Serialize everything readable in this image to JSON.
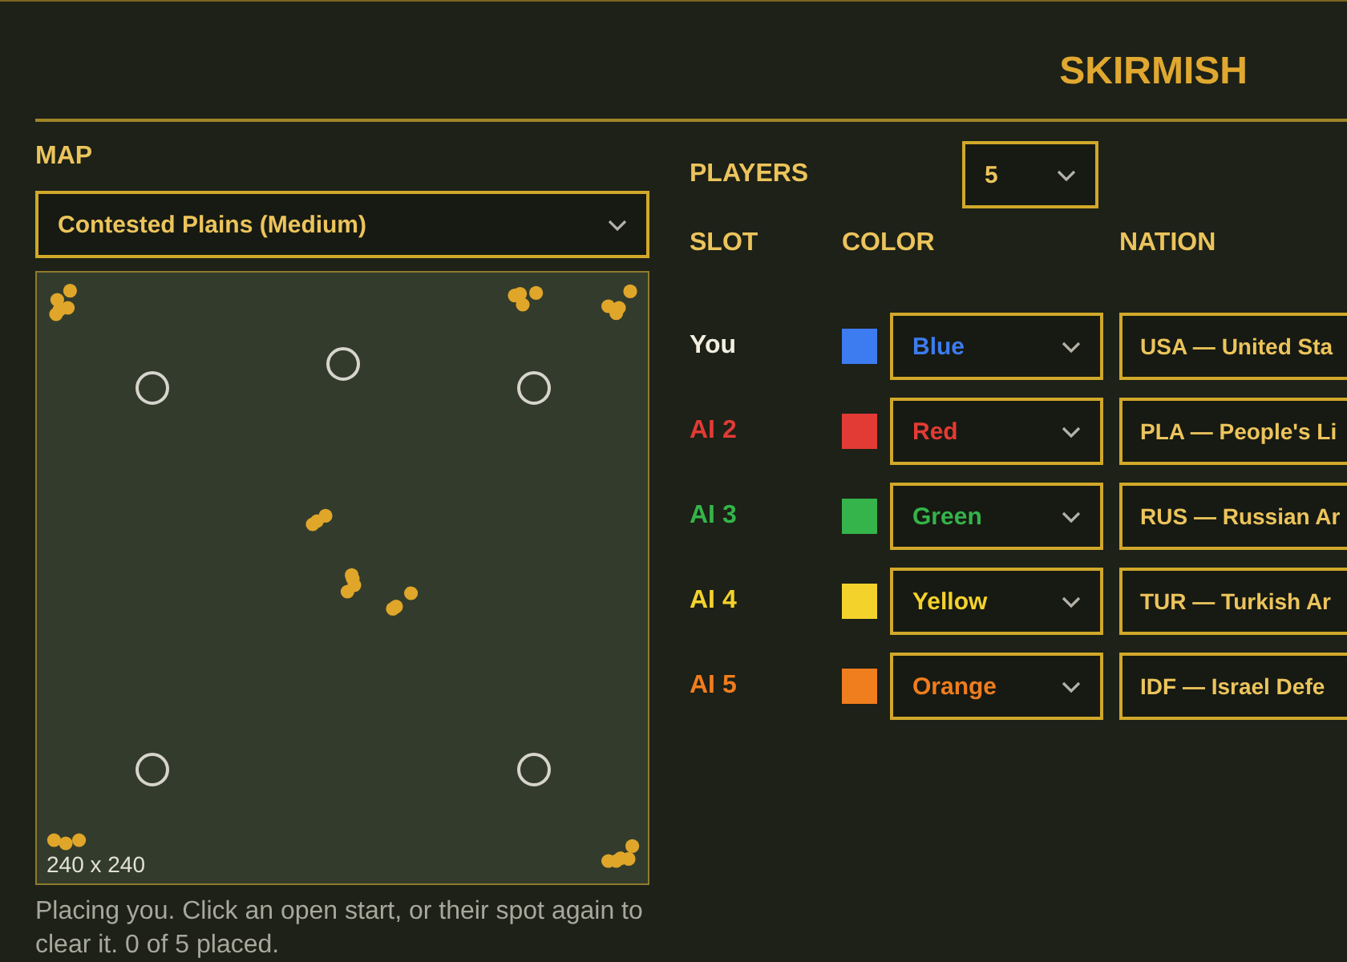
{
  "title": "SKIRMISH",
  "map": {
    "label": "MAP",
    "selected_map": "Contested Plains (Medium)",
    "size_label": "240 x 240",
    "start_spots": [
      {
        "open": true
      },
      {
        "open": true
      },
      {
        "open": true
      },
      {
        "open": true
      },
      {
        "open": true
      }
    ],
    "hint": "Placing you. Click an open start, or their spot again to clear it. 0 of 5 placed."
  },
  "players": {
    "label": "PLAYERS",
    "count": "5",
    "columns": [
      "SLOT",
      "COLOR",
      "NATION"
    ],
    "rows": [
      {
        "kind": "human",
        "slot": "You",
        "color": "#3d7cf0",
        "color_name": "Blue",
        "nation": "USA — United Sta"
      },
      {
        "kind": "ai",
        "slot": "AI 2",
        "color": "#e23b35",
        "color_name": "Red",
        "nation": "PLA — People's Li"
      },
      {
        "kind": "ai",
        "slot": "AI 3",
        "color": "#34b44a",
        "color_name": "Green",
        "nation": "RUS — Russian Ar"
      },
      {
        "kind": "ai",
        "slot": "AI 4",
        "color": "#f4d22c",
        "color_name": "Yellow",
        "nation": "TUR — Turkish Ar"
      },
      {
        "kind": "ai",
        "slot": "AI 5",
        "color": "#f07d1e",
        "color_name": "Orange",
        "nation": "IDF — Israel Defe"
      }
    ]
  }
}
